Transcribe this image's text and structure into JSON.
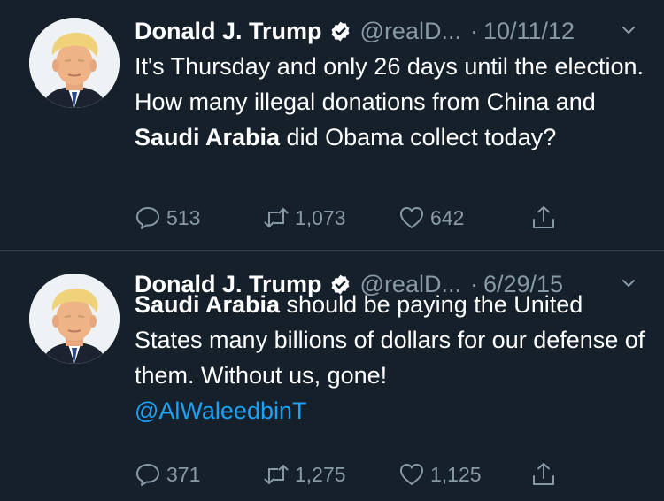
{
  "colors": {
    "background": "#15202b",
    "divider": "#38444d",
    "secondary_text": "#8899a6",
    "link": "#1da1f2",
    "verified": "#ffffff"
  },
  "tweets": [
    {
      "author_name": "Donald J. Trump",
      "handle": "@realD...",
      "separator": "·",
      "date": "10/11/12",
      "text": {
        "part1": "It's Thursday and only 26 days until the election. How many illegal donations from China and ",
        "bold": "Saudi Arabia",
        "part2": " did Obama collect today?"
      },
      "replies": "513",
      "retweets": "1,073",
      "likes": "642",
      "icons": [
        "verified-icon",
        "chevron-down-icon",
        "reply-icon",
        "retweet-icon",
        "heart-icon",
        "share-icon"
      ]
    },
    {
      "author_name": "Donald J. Trump",
      "handle": "@realD...",
      "separator": "·",
      "date": "6/29/15",
      "text": {
        "bold": "Saudi Arabia",
        "part1": " should be paying the United States many billions of dollars for our defense of them. Without us, gone!",
        "mention": "@AlWaleedbinT"
      },
      "replies": "371",
      "retweets": "1,275",
      "likes": "1,125",
      "icons": [
        "verified-icon",
        "chevron-down-icon",
        "reply-icon",
        "retweet-icon",
        "heart-icon",
        "share-icon"
      ]
    }
  ]
}
